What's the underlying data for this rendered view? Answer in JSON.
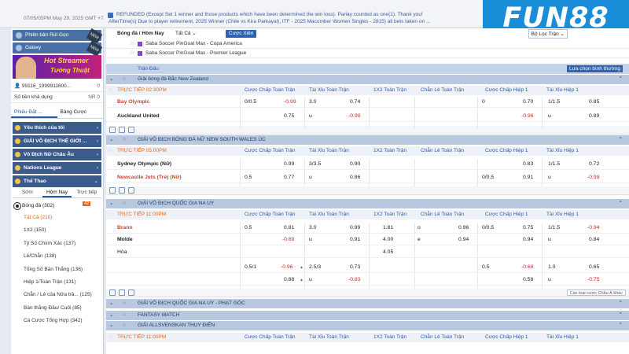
{
  "topbar": {
    "clock": "07/05/05PM May 29, 2025 GMT +7",
    "ticker_line1": "REFUNDED (Except Set 1 winner and those products which have been determined the win loss). Parlay counted as one(1). Thank you!",
    "ticker_line2": "AfterTime(s) Due to player retirement, 2025 Winner (Chile vs Kira Parkayal), ITF - 2025 Macomber Women Singles - 2815) all bets taken on ...",
    "logo": "FUN88"
  },
  "sidebar": {
    "btn_version": "Phiên bản Rút Gọn",
    "btn_galaxy": "Galaxy",
    "banner_line1": "Hot Streamer",
    "banner_line2": "Tường Thuật",
    "account_id": "99116_1999911600...",
    "account_right": "0",
    "balance_label": "Số tiền khả dụng",
    "balance_value": "NR 0",
    "tab_bet_slip": "Phiếu Đặt ...",
    "tab_statement": "Bảng Cược",
    "menu_favorites": "Yêu thích của tôi",
    "menu_world_cup": "GIẢI VÔ ĐỊCH THẾ GIỚI ...",
    "menu_euro_women": "Vô Địch Nữ Châu Âu",
    "menu_nations": "Nations League",
    "menu_sports": "Thể Thao",
    "subtab_early": "Sớm",
    "subtab_today": "Hôm Nay",
    "subtab_live": "Trực tiếp",
    "live_count": "42",
    "sport_soccer": "Bóng đá (302)",
    "bet_types": [
      {
        "label": "Tất Cả (210)",
        "selected": true
      },
      {
        "label": "1X2 (150)",
        "selected": false
      },
      {
        "label": "Tỷ Số Chính Xác (137)",
        "selected": false
      },
      {
        "label": "Lẻ/Chẵn (138)",
        "selected": false
      },
      {
        "label": "Tổng Số Bàn Thắng (136)",
        "selected": false
      },
      {
        "label": "Hiệp 1/Toàn Trận (131)",
        "selected": false
      },
      {
        "label": "Chẵn / Lẻ của Nửa trâ...  (125)",
        "selected": false
      },
      {
        "label": "Bàn thắng Đầu/ Cuối (85)",
        "selected": false
      },
      {
        "label": "Cá Cược Tổng Hợp (342)",
        "selected": false
      }
    ]
  },
  "main": {
    "crumb_sport": "Bóng đá / Hôm Nay",
    "crumb_filter": "Tất Cả",
    "refresh_btn": "Cược Xiên",
    "league_filter": "Bộ Lọc Trận",
    "fav_league1": "Saba Soccer PinGoal Max - Copa America",
    "fav_league2": "Saba Soccer PinGoal Max - Premier League",
    "header": {
      "match": "Trận Đấu",
      "sort": "Lựa chọn bình thường"
    },
    "col_live": "TRỰC TIẾP",
    "cols": [
      "Cược Chấp Toàn Trận",
      "Tài Xỉu Toàn Trận",
      "1X2 Toàn Trận",
      "Chẵn Lẻ Toàn Trận",
      "Cược Chấp Hiệp 1",
      "Tài Xỉu Hiệp 1"
    ],
    "leagues": [
      {
        "name": "Giải bóng đá Bắc New Zealand",
        "time": "02:30PM",
        "home": "Bay Olympic",
        "away": "Auckland United",
        "hdp": "0/0.5",
        "hdp_h": "-0.99",
        "hdp_a": "0.75",
        "ou": "3.0",
        "ou_h": "0.74",
        "ou_u": "u",
        "ou_a": "-0.98",
        "h1_hdp": "0",
        "h1_h": "0.70",
        "h1_a": "-0.96",
        "h1_ou": "1/1.5",
        "h1_ou_h": "0.85",
        "h1_u": "u",
        "h1_ou_a": "0.89"
      },
      {
        "name": "GIẢI VÔ ĐỊCH BÓNG ĐÁ NỮ NEW SOUTH WALES ÚC",
        "time": "05:00PM",
        "home": "Sydney Olympic (Nữ)",
        "away": "Newcastle Jets (Trẻ) (Nữ)",
        "hdp_h": "0.99",
        "hdp_a_line": "0.5",
        "hdp_a": "0.77",
        "ou": "3/3.5",
        "ou_h": "0.90",
        "ou_u": "u",
        "ou_a": "0.86",
        "h1_h": "0.83",
        "h1_a_line": "0/0.5",
        "h1_a": "0.91",
        "h1_ou": "1/1.5",
        "h1_ou_h": "0.72",
        "h1_u": "u",
        "h1_ou_a": "-0.98"
      },
      {
        "name": "GIẢI VÔ ĐỊCH QUỐC GIA NA UY",
        "time": "11:00PM",
        "home": "Brann",
        "away": "Molde",
        "draw": "Hòa",
        "hdp": "0.5",
        "hdp_h": "0.81",
        "hdp_a": "-0.89",
        "ou": "3.0",
        "ou_h": "0.99",
        "ou_u": "u",
        "ou_a": "0.91",
        "x_h": "1.81",
        "x_a": "4.00",
        "x_d": "4.05",
        "oe_o": "o",
        "oe_h": "0.96",
        "oe_e": "e",
        "oe_a": "0.94",
        "h1_hdp": "0/0.5",
        "h1_h": "0.75",
        "h1_a": "0.94",
        "h1_ou": "1/1.5",
        "h1_ou_h": "-0.94",
        "h1_u": "u",
        "h1_ou_a": "0.84",
        "alt_hdp": "0.5/1",
        "alt_hdp_h": "-0.96",
        "alt_hdp_a": "0.88",
        "alt_ou": "2.5/3",
        "alt_ou_h": "0.73",
        "alt_u": "u",
        "alt_ou_a": "-0.83",
        "alt_h1": "0.5",
        "alt_h1_h": "-0.68",
        "alt_h1_a": "0.58",
        "alt_h1_ou": "1.0",
        "alt_h1_ou_h": "0.65",
        "alt_h1_u": "u",
        "alt_h1_ou_a": "-0.75"
      }
    ],
    "more_bets": "Các loại cược Châu Á khác",
    "league4": "GIẢI VÔ ĐỊCH QUỐC GIA NA UY - PHẠT GÓC",
    "league5": "FANTASY MATCH",
    "league6": "GIẢI ALLSVENSKAN THỤY ĐIỂN",
    "time6": "11:00PM"
  }
}
